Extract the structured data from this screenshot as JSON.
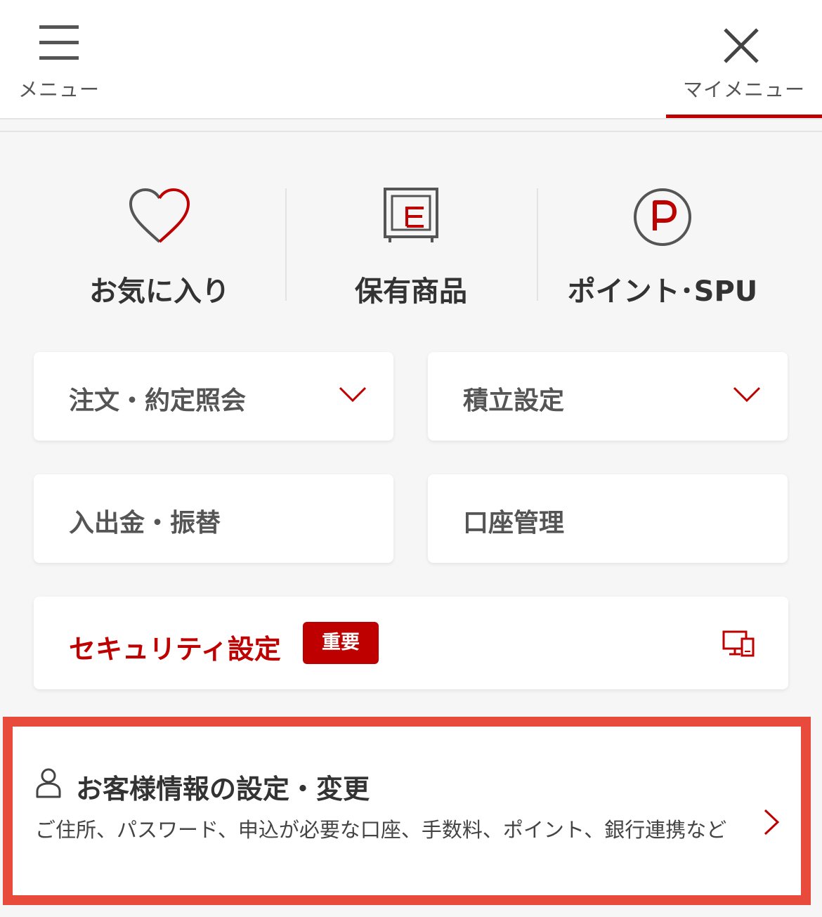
{
  "header": {
    "menu_label": "メニュー",
    "mymenu_label": "マイメニュー"
  },
  "shortcuts": [
    {
      "label": "お気に入り",
      "icon": "heart-icon"
    },
    {
      "label": "保有商品",
      "icon": "holdings-icon"
    },
    {
      "label": "ポイント･SPU",
      "icon": "point-p-icon"
    }
  ],
  "cards": {
    "orders": "注文・約定照会",
    "savings": "積立設定",
    "deposit": "入出金・振替",
    "account": "口座管理"
  },
  "security": {
    "label": "セキュリティ設定",
    "badge": "重要"
  },
  "customer": {
    "title": "お客様情報の設定・変更",
    "description": "ご住所、パスワード、申込が必要な口座、手数料、ポイント、銀行連携など"
  },
  "colors": {
    "accent": "#bf0000",
    "highlight_frame": "#e84a3c"
  }
}
